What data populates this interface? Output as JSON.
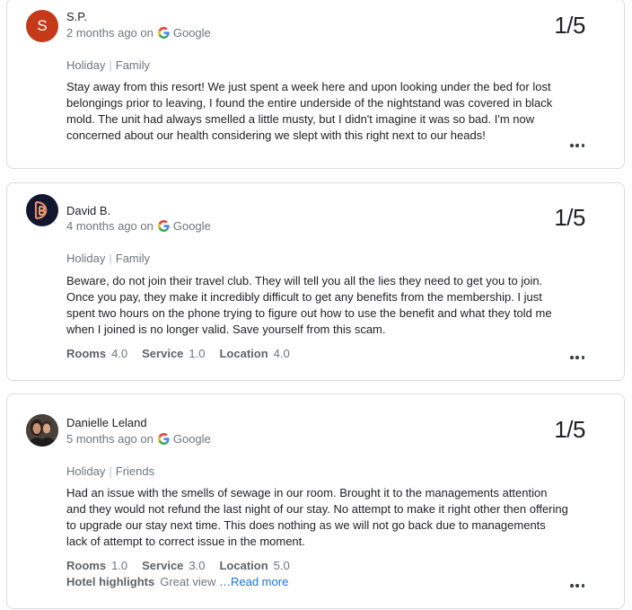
{
  "reviews": [
    {
      "author": "S.P.",
      "avatar_letter": "S",
      "avatar_color": "#c5391b",
      "time": "2 months ago on",
      "source": "Google",
      "rating": "1/5",
      "trip_type": "Holiday",
      "travel_group": "Family",
      "text": "Stay away from this resort! We just spent a week here and upon looking under the bed for lost belongings prior to leaving, I found the entire underside of the nightstand was covered in black mold. The unit had always smelled a little musty, but I didn't imagine it was so bad. I'm now concerned about our health considering we slept with this right next to our heads!"
    },
    {
      "author": "David B.",
      "avatar_letter": "D",
      "avatar_color": "#12172f",
      "time": "4 months ago on",
      "source": "Google",
      "rating": "1/5",
      "trip_type": "Holiday",
      "travel_group": "Family",
      "text": "Beware, do not join their travel club. They will tell you all the lies they need to get you to join. Once you pay, they make it incredibly difficult to get any benefits from the membership. I just spent two hours on the phone trying to figure out how to use the benefit and what they told me when I joined is no longer valid. Save yourself from this scam.",
      "scores": [
        {
          "label": "Rooms",
          "value": "4.0"
        },
        {
          "label": "Service",
          "value": "1.0"
        },
        {
          "label": "Location",
          "value": "4.0"
        }
      ]
    },
    {
      "author": "Danielle Leland",
      "time": "5 months ago on",
      "source": "Google",
      "rating": "1/5",
      "trip_type": "Holiday",
      "travel_group": "Friends",
      "text": "Had an issue with the smells of sewage in our room. Brought it to the managements attention and they would not refund the last night of our stay. No attempt to make it right other then offering to upgrade our stay next time. This does nothing as we will not go back due to managements lack of attempt to correct issue in the moment.",
      "scores": [
        {
          "label": "Rooms",
          "value": "1.0"
        },
        {
          "label": "Service",
          "value": "3.0"
        },
        {
          "label": "Location",
          "value": "5.0"
        }
      ],
      "highlights_label": "Hotel highlights",
      "highlights_value": "Great view",
      "read_more": "…Read more"
    }
  ],
  "colors": {
    "google_blue": "#4285F4",
    "google_red": "#EA4335",
    "google_yellow": "#FBBC05",
    "google_green": "#34A853",
    "link": "#1a73e8"
  }
}
